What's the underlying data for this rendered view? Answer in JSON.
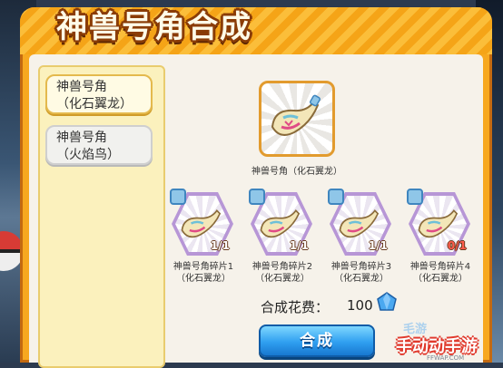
{
  "title": "神兽号角合成",
  "list": {
    "items": [
      {
        "line1": "神兽号角",
        "line2": "（化石翼龙）",
        "selected": true
      },
      {
        "line1": "神兽号角",
        "line2": "（火焰鸟）",
        "selected": false
      }
    ]
  },
  "target": {
    "name": "神兽号角（化石翼龙）"
  },
  "fragments": [
    {
      "name": "神兽号角碎片1",
      "sub": "（化石翼龙）",
      "count": "1/1"
    },
    {
      "name": "神兽号角碎片2",
      "sub": "（化石翼龙）",
      "count": "1/1"
    },
    {
      "name": "神兽号角碎片3",
      "sub": "（化石翼龙）",
      "count": "1/1"
    },
    {
      "name": "神兽号角碎片4",
      "sub": "（化石翼龙）",
      "count": "0/1"
    }
  ],
  "cost": {
    "label": "合成花费：",
    "value": "100",
    "icon": "diamond-icon"
  },
  "button": {
    "label": "合成"
  },
  "watermark": {
    "top": "毛游",
    "main": "手动动手游",
    "url": "FFWAP.COM"
  },
  "colors": {
    "frame": "#f7a81f",
    "button": "#2f9ff0",
    "fragment_border": "#b796d6"
  }
}
